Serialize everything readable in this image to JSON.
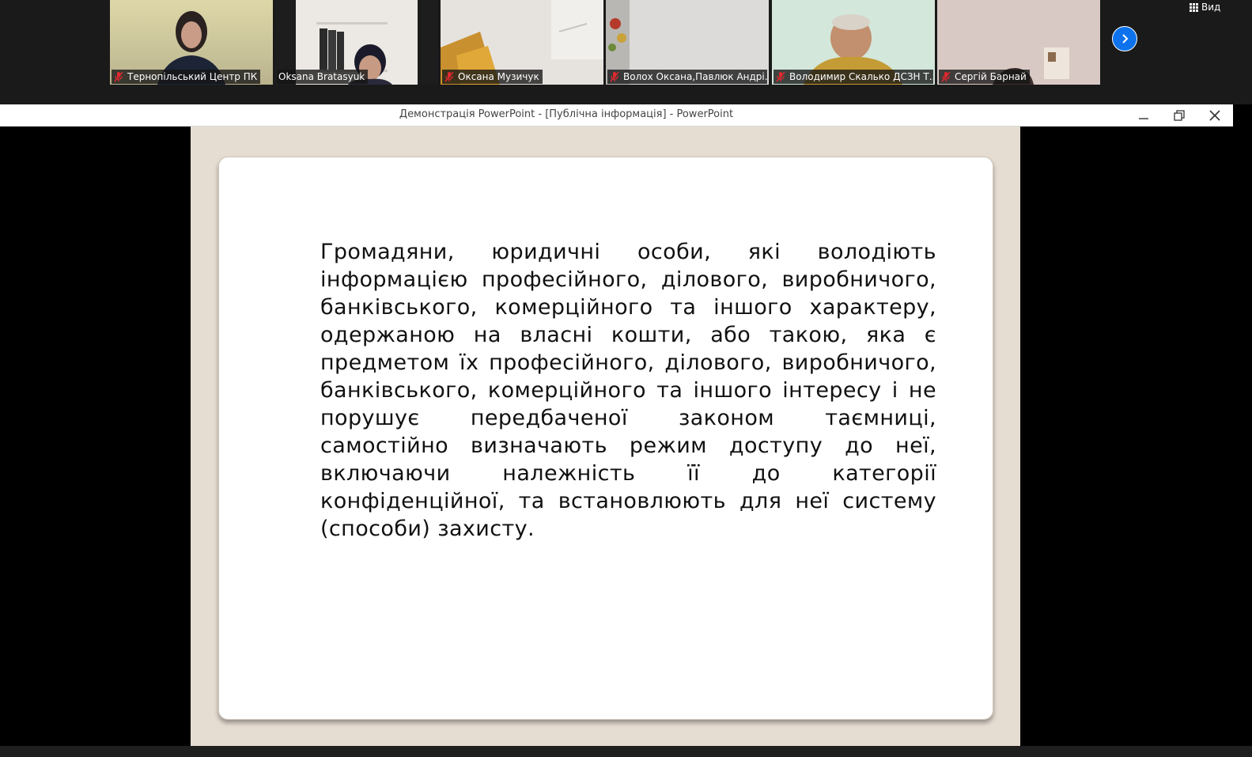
{
  "participants": [
    {
      "name": "Тернопільський Центр ПК",
      "muted": true,
      "active": false
    },
    {
      "name": "Oksana Bratasyuk",
      "muted": false,
      "active": true
    },
    {
      "name": "Оксана Музичук",
      "muted": true,
      "active": false
    },
    {
      "name": "Волох Оксана,Павлюк Андрі...",
      "muted": true,
      "active": false
    },
    {
      "name": "Володимир Скалько ДСЗН Т...",
      "muted": true,
      "active": false
    },
    {
      "name": "Сергій Барнай",
      "muted": true,
      "active": false
    }
  ],
  "view_button": {
    "label": "Вид",
    "icon": "grid-icon"
  },
  "next_button": {
    "icon": "chevron-right-icon"
  },
  "window": {
    "title": "Демонстрація PowerPoint - [Публічна інформація] - PowerPoint",
    "controls": [
      "minimize-icon",
      "restore-icon",
      "close-icon"
    ]
  },
  "slide": {
    "body": "Громадяни, юридичні особи, які володіють інформацією професійного, ділового, виробничого, банківського, комерційного та іншого характеру, одержаною на власні кошти, або такою, яка є предметом їх професійного, ділового, виробничого, банківського, комерційного та іншого інтересу і не порушує передбаченої законом таємниці, самостійно визначають режим доступу до неї, включаючи належність її до категорії конфіденційної, та встановлюють для неї систему (способи) захисту."
  },
  "colors": {
    "accent": "#0e72ed",
    "muted_mic": "#e0282e",
    "slide_background": "#e6ddd2",
    "active_speaker": "#8fd14f"
  }
}
